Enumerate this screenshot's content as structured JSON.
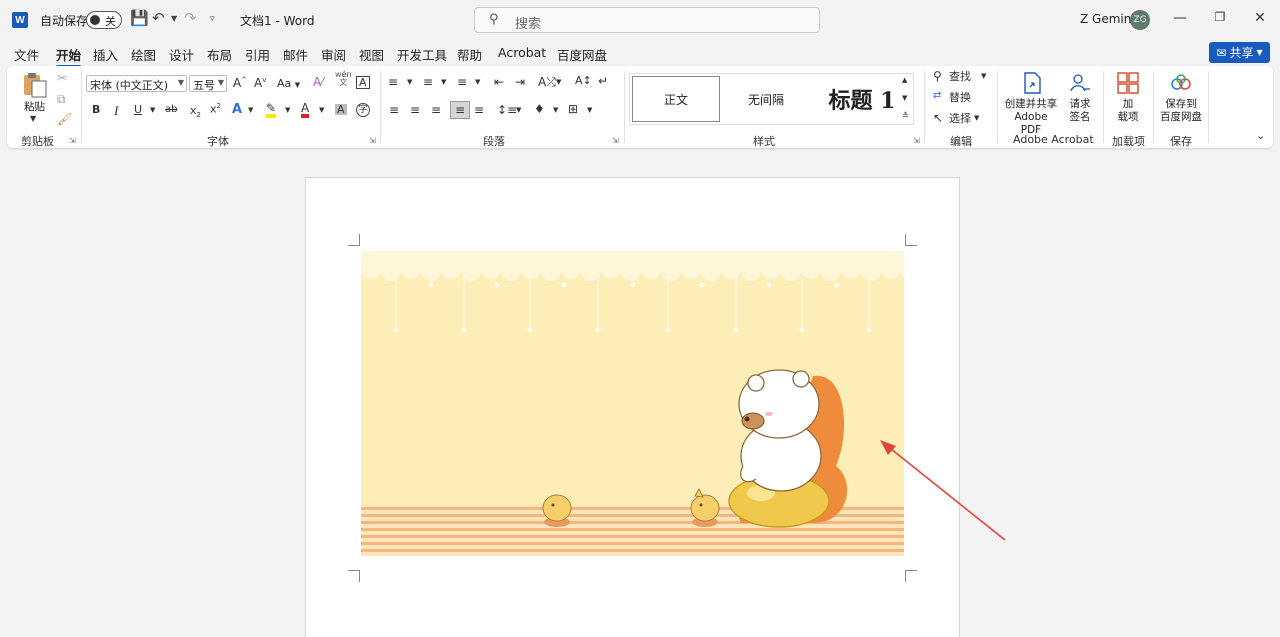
{
  "titlebar": {
    "app_icon": "word-logo-icon",
    "autosave_label": "自动保存",
    "autosave_state": "关",
    "document_title": "文档1 - Word",
    "search_placeholder": "搜索",
    "user_name": "Z Gemini",
    "user_initials": "ZG"
  },
  "menu": {
    "tabs": [
      "文件",
      "开始",
      "插入",
      "绘图",
      "设计",
      "布局",
      "引用",
      "邮件",
      "审阅",
      "视图",
      "开发工具",
      "帮助",
      "Acrobat",
      "百度网盘"
    ],
    "active": "开始",
    "share_label": "共享"
  },
  "ribbon": {
    "clipboard": {
      "paste_label": "粘贴",
      "group_label": "剪贴板"
    },
    "font": {
      "font_name": "宋体 (中文正文)",
      "font_size": "五号",
      "group_label": "字体",
      "case_label": "Aa",
      "phonetic_label": "wén"
    },
    "paragraph": {
      "group_label": "段落"
    },
    "styles": {
      "items": [
        "正文",
        "无间隔",
        "标题 1"
      ],
      "selected": "正文",
      "group_label": "样式"
    },
    "editing": {
      "find_label": "查找",
      "replace_label": "替换",
      "select_label": "选择",
      "group_label": "编辑"
    },
    "adobe": {
      "create_line1": "创建并共享",
      "create_line2": "Adobe PDF",
      "sign_line1": "请求",
      "sign_line2": "签名",
      "group_label": "Adobe Acrobat"
    },
    "addins": {
      "line1": "加",
      "line2": "载项",
      "group_label": "加载项"
    },
    "save": {
      "line1": "保存到",
      "line2": "百度网盘",
      "group_label": "保存"
    }
  },
  "document": {
    "picture_description_colors": {
      "background": "#fdeeb8",
      "stripes": "#f5b67a",
      "accent": "#e2443b"
    }
  }
}
